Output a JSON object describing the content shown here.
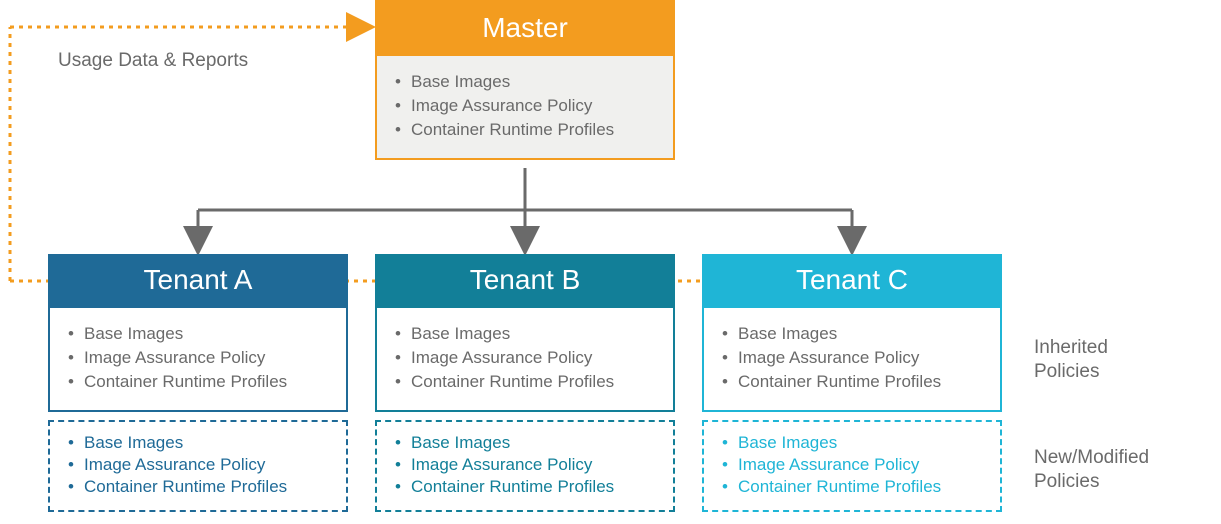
{
  "usage_label": "Usage Data & Reports",
  "master": {
    "title": "Master",
    "items": [
      "Base Images",
      "Image Assurance Policy",
      "Container Runtime Profiles"
    ]
  },
  "tenants": [
    {
      "key": "a",
      "title": "Tenant A",
      "color": "#1f6a97",
      "inherited": [
        "Base Images",
        "Image Assurance Policy",
        "Container Runtime Profiles"
      ],
      "new": [
        "Base Images",
        "Image Assurance Policy",
        "Container Runtime Profiles"
      ]
    },
    {
      "key": "b",
      "title": "Tenant B",
      "color": "#127f98",
      "inherited": [
        "Base Images",
        "Image Assurance Policy",
        "Container Runtime Profiles"
      ],
      "new": [
        "Base Images",
        "Image Assurance Policy",
        "Container Runtime Profiles"
      ]
    },
    {
      "key": "c",
      "title": "Tenant C",
      "color": "#1fb5d6",
      "inherited": [
        "Base Images",
        "Image Assurance Policy",
        "Container Runtime Profiles"
      ],
      "new": [
        "Base Images",
        "Image Assurance Policy",
        "Container Runtime Profiles"
      ]
    }
  ],
  "side_labels": {
    "inherited": "Inherited\nPolicies",
    "new": "New/Modified\nPolicies"
  },
  "colors": {
    "orange": "#f39c1f",
    "gray_line": "#6a6a6a"
  }
}
